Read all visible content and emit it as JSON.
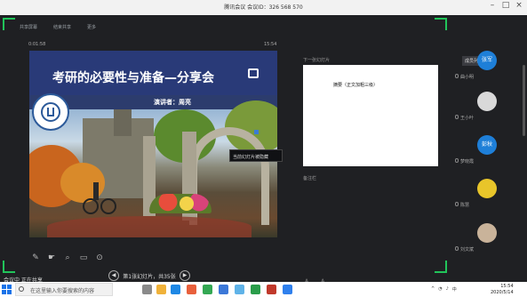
{
  "window": {
    "title": "腾讯会议 会议ID：326 568 570"
  },
  "toolbar": {
    "items": [
      "共享屏幕",
      "结束共享",
      "更多"
    ]
  },
  "slide_panel": {
    "time_elapsed": "0:01:58",
    "time_now": "15:54"
  },
  "slide": {
    "title": "考研的必要性与准备—分享会",
    "presenter": "演讲者：周亮"
  },
  "tooltip": "当前幻灯片被隐藏",
  "annotation_tools": [
    "pen-icon",
    "laser-icon",
    "zoom-icon",
    "screen-icon",
    "more-icon"
  ],
  "pager": {
    "prev": "◀",
    "next": "▶",
    "label": "第1张幻灯片，共35张"
  },
  "notes": {
    "label": "下一张幻灯片",
    "content": "摘要（正文加粗三级）",
    "next_label": "备注栏"
  },
  "sidebar": {
    "top_button": "成员列表",
    "participants": [
      {
        "initials": "张军",
        "name": "曲小明",
        "color": "#1e7fd8"
      },
      {
        "initials": "",
        "name": "王小叶",
        "color": "#d9d9d9"
      },
      {
        "initials": "彭秋",
        "name": "梦晓霞",
        "color": "#1e7fd8"
      },
      {
        "initials": "",
        "name": "陈慧",
        "color": "#e8c52a"
      },
      {
        "initials": "",
        "name": "刘文斌",
        "color": "#c9b39a"
      }
    ]
  },
  "status": {
    "left_text": "会议中  正在共享"
  },
  "taskbar": {
    "search_placeholder": "在这里输入你要搜索的内容",
    "clock_time": "15:54",
    "clock_date": "2020/5/14"
  }
}
